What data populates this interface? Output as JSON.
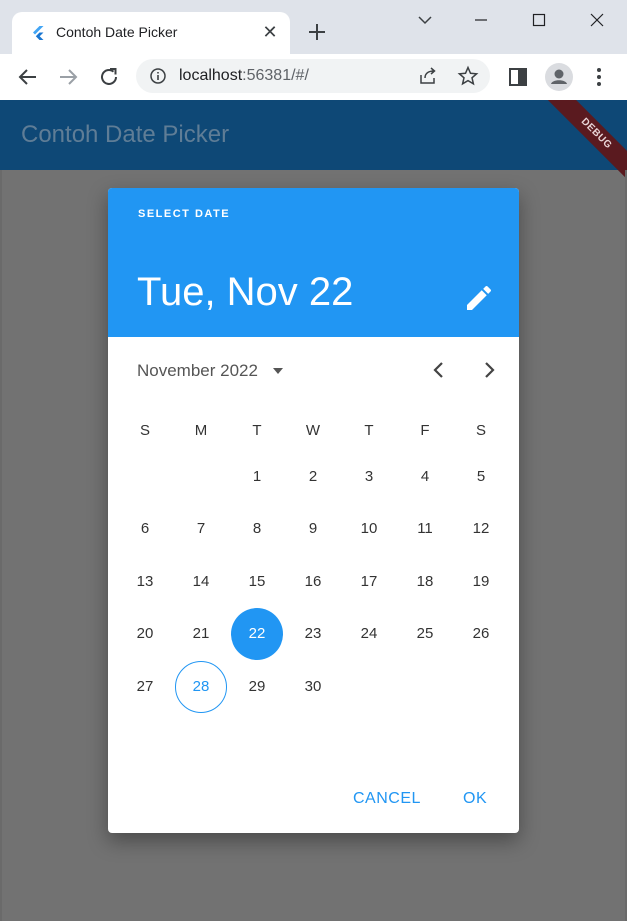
{
  "browser": {
    "tab_title": "Contoh Date Picker",
    "url_host": "localhost",
    "url_rest": ":56381/#/"
  },
  "app": {
    "title": "Contoh Date Picker",
    "debug_banner": "DEBUG"
  },
  "dialog": {
    "help_text": "SELECT DATE",
    "selected_date": "Tue, Nov 22",
    "month_label": "November 2022",
    "weekdays": [
      "S",
      "M",
      "T",
      "W",
      "T",
      "F",
      "S"
    ],
    "weeks": [
      [
        "",
        "",
        "1",
        "2",
        "3",
        "4",
        "5"
      ],
      [
        "6",
        "7",
        "8",
        "9",
        "10",
        "11",
        "12"
      ],
      [
        "13",
        "14",
        "15",
        "16",
        "17",
        "18",
        "19"
      ],
      [
        "20",
        "21",
        "22",
        "23",
        "24",
        "25",
        "26"
      ],
      [
        "27",
        "28",
        "29",
        "30",
        "",
        "",
        ""
      ]
    ],
    "selected_day": "22",
    "today_day": "28",
    "cancel_label": "CANCEL",
    "ok_label": "OK"
  },
  "colors": {
    "accent": "#2196f3",
    "appbar": "#0e4876",
    "scrim": "#727272"
  }
}
